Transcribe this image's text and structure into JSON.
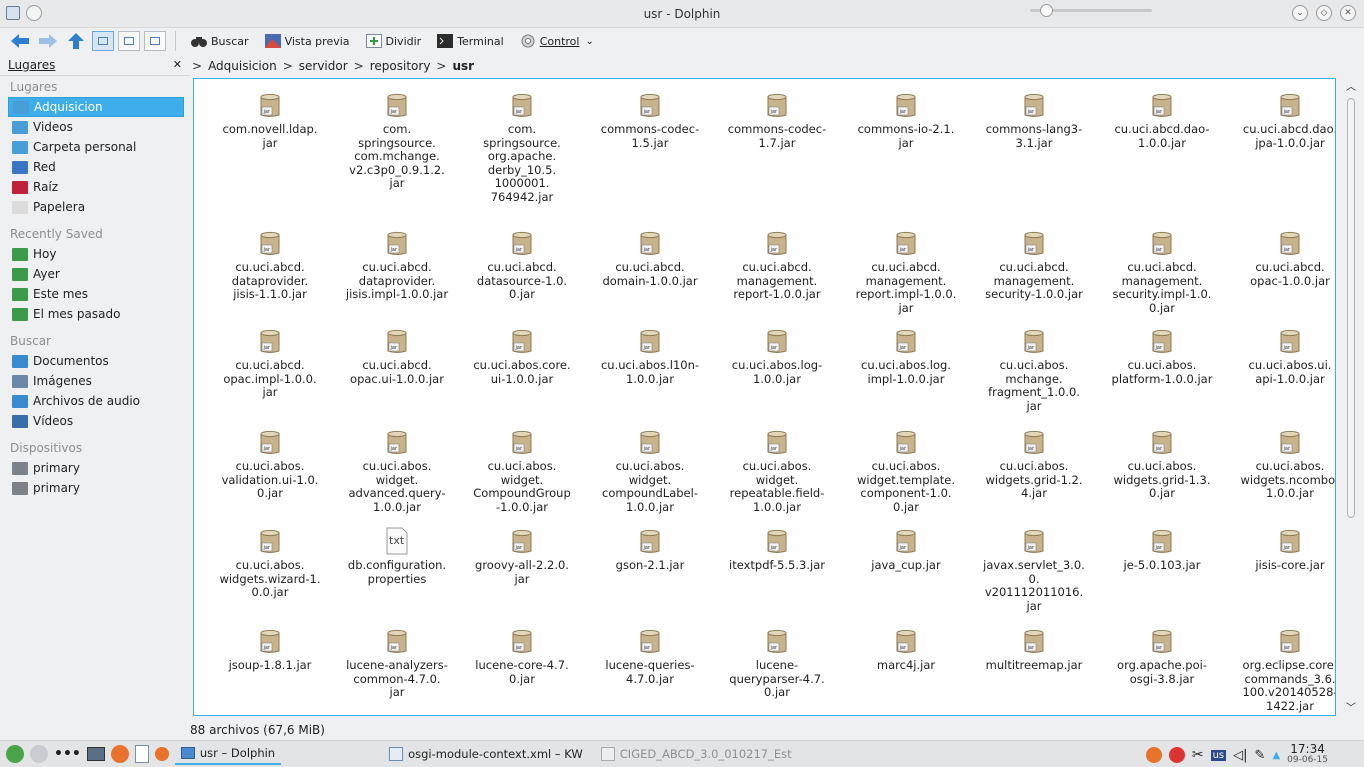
{
  "window": {
    "title": "usr - Dolphin",
    "controls": [
      "minimize",
      "maximize",
      "close"
    ]
  },
  "toolbar": {
    "buscar": "Buscar",
    "vista_previa": "Vista previa",
    "dividir": "Dividir",
    "terminal": "Terminal",
    "control": "Control"
  },
  "sidebar": {
    "header": "Lugares",
    "sections": {
      "lugares": "Lugares",
      "recently_saved": "Recently Saved",
      "buscar": "Buscar",
      "dispositivos": "Dispositivos"
    },
    "lugares_items": [
      {
        "label": "Adquisicion",
        "icon": "folder-icon"
      },
      {
        "label": "Videos",
        "icon": "folder-icon"
      },
      {
        "label": "Carpeta personal",
        "icon": "home-folder-icon"
      },
      {
        "label": "Red",
        "icon": "network-icon"
      },
      {
        "label": "Raíz",
        "icon": "root-folder-icon"
      },
      {
        "label": "Papelera",
        "icon": "trash-icon"
      }
    ],
    "recent_items": [
      {
        "label": "Hoy",
        "icon": "calendar-icon"
      },
      {
        "label": "Ayer",
        "icon": "calendar-icon"
      },
      {
        "label": "Este mes",
        "icon": "calendar-icon"
      },
      {
        "label": "El mes pasado",
        "icon": "calendar-icon"
      }
    ],
    "buscar_items": [
      {
        "label": "Documentos",
        "icon": "documents-icon"
      },
      {
        "label": "Imágenes",
        "icon": "images-icon"
      },
      {
        "label": "Archivos de audio",
        "icon": "audio-icon"
      },
      {
        "label": "Vídeos",
        "icon": "video-icon"
      }
    ],
    "device_items": [
      {
        "label": "primary",
        "icon": "drive-icon"
      },
      {
        "label": "primary",
        "icon": "drive-icon"
      }
    ]
  },
  "breadcrumb": {
    "parts": [
      "Adquisicion",
      "servidor",
      "repository"
    ],
    "current": "usr"
  },
  "files": [
    "com.novell.ldap.\njar",
    "com.\nspringsource.\ncom.mchange.\nv2.c3p0_0.9.1.2.\njar",
    "com.\nspringsource.\norg.apache.\nderby_10.5.\n1000001.\n764942.jar",
    "commons-codec-\n1.5.jar",
    "commons-codec-\n1.7.jar",
    "commons-io-2.1.\njar",
    "commons-lang3-\n3.1.jar",
    "cu.uci.abcd.dao-\n1.0.0.jar",
    "cu.uci.abcd.dao.\njpa-1.0.0.jar",
    "cu.uci.abcd.\ndataprovider.\njisis-1.1.0.jar",
    "cu.uci.abcd.\ndataprovider.\njisis.impl-1.0.0.jar",
    "cu.uci.abcd.\ndatasource-1.0.\n0.jar",
    "cu.uci.abcd.\ndomain-1.0.0.jar",
    "cu.uci.abcd.\nmanagement.\nreport-1.0.0.jar",
    "cu.uci.abcd.\nmanagement.\nreport.impl-1.0.0.\njar",
    "cu.uci.abcd.\nmanagement.\nsecurity-1.0.0.jar",
    "cu.uci.abcd.\nmanagement.\nsecurity.impl-1.0.\n0.jar",
    "cu.uci.abcd.\nopac-1.0.0.jar",
    "cu.uci.abcd.\nopac.impl-1.0.0.\njar",
    "cu.uci.abcd.\nopac.ui-1.0.0.jar",
    "cu.uci.abos.core.\nui-1.0.0.jar",
    "cu.uci.abos.l10n-\n1.0.0.jar",
    "cu.uci.abos.log-\n1.0.0.jar",
    "cu.uci.abos.log.\nimpl-1.0.0.jar",
    "cu.uci.abos.\nmchange.\nfragment_1.0.0.\njar",
    "cu.uci.abos.\nplatform-1.0.0.jar",
    "cu.uci.abos.ui.\napi-1.0.0.jar",
    "cu.uci.abos.\nvalidation.ui-1.0.\n0.jar",
    "cu.uci.abos.\nwidget.\nadvanced.query-\n1.0.0.jar",
    "cu.uci.abos.\nwidget.\nCompoundGroup\n-1.0.0.jar",
    "cu.uci.abos.\nwidget.\ncompoundLabel-\n1.0.0.jar",
    "cu.uci.abos.\nwidget.\nrepeatable.field-\n1.0.0.jar",
    "cu.uci.abos.\nwidget.template.\ncomponent-1.0.\n0.jar",
    "cu.uci.abos.\nwidgets.grid-1.2.\n4.jar",
    "cu.uci.abos.\nwidgets.grid-1.3.\n0.jar",
    "cu.uci.abos.\nwidgets.ncombo-\n1.0.0.jar",
    "cu.uci.abos.\nwidgets.wizard-1.\n0.0.jar",
    "db.configuration.\nproperties",
    "groovy-all-2.2.0.\njar",
    "gson-2.1.jar",
    "itextpdf-5.5.3.jar",
    "java_cup.jar",
    "javax.servlet_3.0.\n0.\nv201112011016.\njar",
    "je-5.0.103.jar",
    "jisis-core.jar",
    "jsoup-1.8.1.jar",
    "lucene-analyzers-\ncommon-4.7.0.\njar",
    "lucene-core-4.7.\n0.jar",
    "lucene-queries-\n4.7.0.jar",
    "lucene-\nqueryparser-4.7.\n0.jar",
    "marc4j.jar",
    "multitreemap.jar",
    "org.apache.poi-\nosgi-3.8.jar",
    "org.eclipse.core.\ncommands_3.6.\n100.v20140528-\n1422.jar"
  ],
  "properties_file_index": 37,
  "status": {
    "summary": "88 archivos (67,6 MiB)"
  },
  "taskbar": {
    "tasks": [
      "usr – Dolphin",
      "osgi-module-context.xml – KW",
      "CIGED_ABCD_3.0_010217_Est"
    ],
    "clock_time": "17:34",
    "clock_date": "09-06-15",
    "keyboard_layout": "us"
  }
}
